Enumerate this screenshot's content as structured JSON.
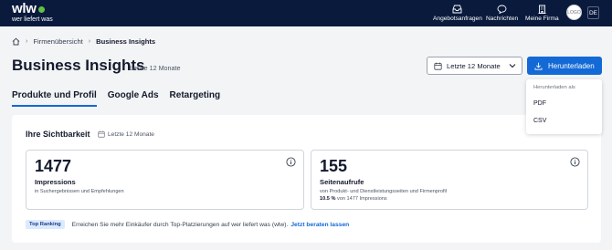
{
  "topbar": {
    "logo_word": "wlw",
    "logo_tagline": "wer liefert was",
    "nav": [
      {
        "label": "Angebotsanfragen",
        "icon": "inbox-icon"
      },
      {
        "label": "Nachrichten",
        "icon": "chat-icon"
      },
      {
        "label": "Meine Firma",
        "icon": "building-icon"
      }
    ],
    "avatar_text": "LOGO",
    "language": "DE"
  },
  "breadcrumb": {
    "home_icon": "home-icon",
    "items": [
      "Firmenübersicht",
      "Business Insights"
    ]
  },
  "header": {
    "title": "Business Insights",
    "subtitle": "Letzte 12 Monate",
    "date_select": {
      "value": "Letzte 12 Monate",
      "icon": "calendar-icon"
    },
    "download_label": "Herunterladen"
  },
  "download_menu": {
    "heading": "Herunterladen als",
    "options": [
      "PDF",
      "CSV"
    ]
  },
  "tabs": [
    {
      "label": "Produkte und Profil",
      "active": true
    },
    {
      "label": "Google Ads",
      "active": false
    },
    {
      "label": "Retargeting",
      "active": false
    }
  ],
  "visibility": {
    "title": "Ihre Sichtbarkeit",
    "period": "Letzte 12 Monate",
    "metrics": [
      {
        "value": "1477",
        "label": "Impressions",
        "description": "in Suchergebnissen und Empfehlungen"
      },
      {
        "value": "155",
        "label": "Seitenaufrufe",
        "description": "von Produkt- und Dienstleistungsseiten und Firmenprofil",
        "share_value": "10.5 %",
        "share_text": "von 1477 Impressions"
      }
    ],
    "tip": {
      "badge": "Top Ranking",
      "text": "Erreichen Sie mehr Einkäufer durch Top-Platzierungen auf wer liefert was (wlw).",
      "link": "Jetzt beraten lassen"
    }
  },
  "colors": {
    "navy": "#0a1a3d",
    "accent": "#1369d6",
    "logo_green": "#62c044"
  }
}
